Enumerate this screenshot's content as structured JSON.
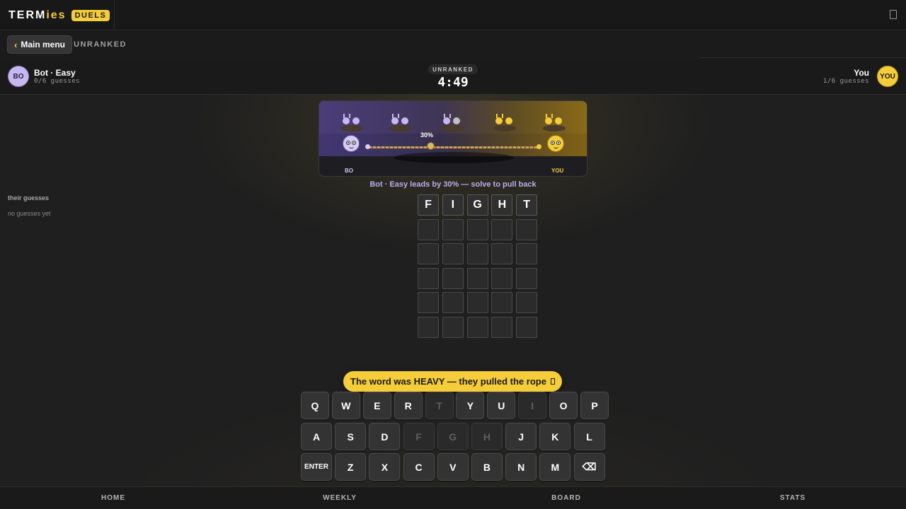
{
  "brand": {
    "word_main": "TERM",
    "word_accent": "ies",
    "badge": "DUELS"
  },
  "header": {
    "icon": "book-icon"
  },
  "subbar": {
    "back_label": "Main menu",
    "mode": "UNRANKED"
  },
  "players": {
    "bot": {
      "avatar": "BO",
      "name": "Bot · Easy",
      "guesses": "0/6 guesses"
    },
    "you": {
      "avatar": "YOU",
      "name": "You",
      "guesses": "1/6 guesses"
    }
  },
  "match": {
    "tag": "UNRANKED",
    "timer": "4:49"
  },
  "scene": {
    "percent": "30%",
    "bot_label": "BO",
    "you_label": "YOU",
    "rope_position": 0.3
  },
  "status_message": "Bot · Easy leads by 30% — solve to pull back",
  "sidebar": {
    "title": "their guesses",
    "empty": "no guesses yet"
  },
  "grid": {
    "rows": [
      [
        "F",
        "I",
        "G",
        "H",
        "T"
      ],
      [
        "",
        "",
        "",
        "",
        ""
      ],
      [
        "",
        "",
        "",
        "",
        ""
      ],
      [
        "",
        "",
        "",
        "",
        ""
      ],
      [
        "",
        "",
        "",
        "",
        ""
      ],
      [
        "",
        "",
        "",
        "",
        ""
      ]
    ]
  },
  "toast": {
    "text": "The word was HEAVY — they pulled the rope",
    "icon": "rope-icon"
  },
  "keyboard": {
    "row1": [
      {
        "k": "Q"
      },
      {
        "k": "W"
      },
      {
        "k": "E"
      },
      {
        "k": "R"
      },
      {
        "k": "T",
        "used": true
      },
      {
        "k": "Y"
      },
      {
        "k": "U"
      },
      {
        "k": "I",
        "used": true
      },
      {
        "k": "O"
      },
      {
        "k": "P"
      }
    ],
    "row2": [
      {
        "k": "A"
      },
      {
        "k": "S"
      },
      {
        "k": "D"
      },
      {
        "k": "F",
        "used": true
      },
      {
        "k": "G",
        "used": true
      },
      {
        "k": "H",
        "used": true
      },
      {
        "k": "J"
      },
      {
        "k": "K"
      },
      {
        "k": "L"
      }
    ],
    "row3": [
      {
        "k": "ENTER",
        "wide": true
      },
      {
        "k": "Z"
      },
      {
        "k": "X"
      },
      {
        "k": "C"
      },
      {
        "k": "V"
      },
      {
        "k": "B"
      },
      {
        "k": "N"
      },
      {
        "k": "M"
      },
      {
        "k": "⌫"
      }
    ]
  },
  "nav": [
    "HOME",
    "WEEKLY",
    "BOARD",
    "STATS"
  ],
  "colors": {
    "accent": "#f5cc3a",
    "bot": "#c8b8f0",
    "background": "#1f1f1f"
  }
}
